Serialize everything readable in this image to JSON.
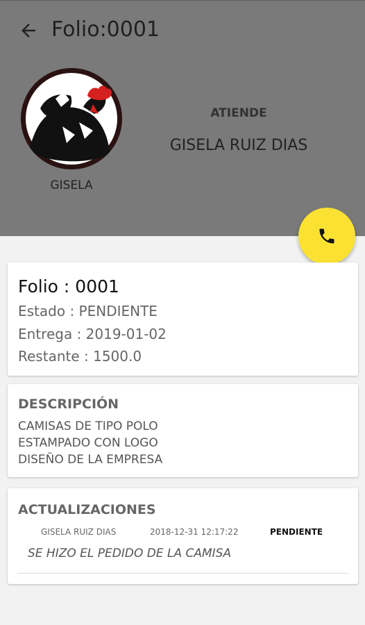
{
  "toolbar": {
    "title": "Folio:0001",
    "back_icon": "arrow-back-icon"
  },
  "profile": {
    "avatar_icon": "rooster-avatar",
    "name": "GISELA"
  },
  "attends": {
    "label": "ATIENDE",
    "name": "GISELA RUIZ DIAS"
  },
  "call_button": {
    "icon": "phone-icon",
    "color": "#fbe232"
  },
  "summary": {
    "folio": "Folio : 0001",
    "status": "Estado : PENDIENTE",
    "delivery": "Entrega : 2019-01-02",
    "remaining": "Restante : 1500.0"
  },
  "description": {
    "title": "DESCRIPCIÓN",
    "lines": [
      "CAMISAS DE TIPO POLO",
      "ESTAMPADO CON LOGO",
      "DISEÑO DE LA EMPRESA"
    ]
  },
  "updates": {
    "title": "ACTUALIZACIONES",
    "items": [
      {
        "user": "GISELA RUIZ DIAS",
        "datetime": "2018-12-31 12:17:22",
        "status": "PENDIENTE",
        "message": "SE HIZO EL PEDIDO DE LA CAMISA"
      }
    ]
  },
  "colors": {
    "header": "#7a7a7a",
    "background": "#f2f2f2",
    "fab": "#fbe232"
  }
}
